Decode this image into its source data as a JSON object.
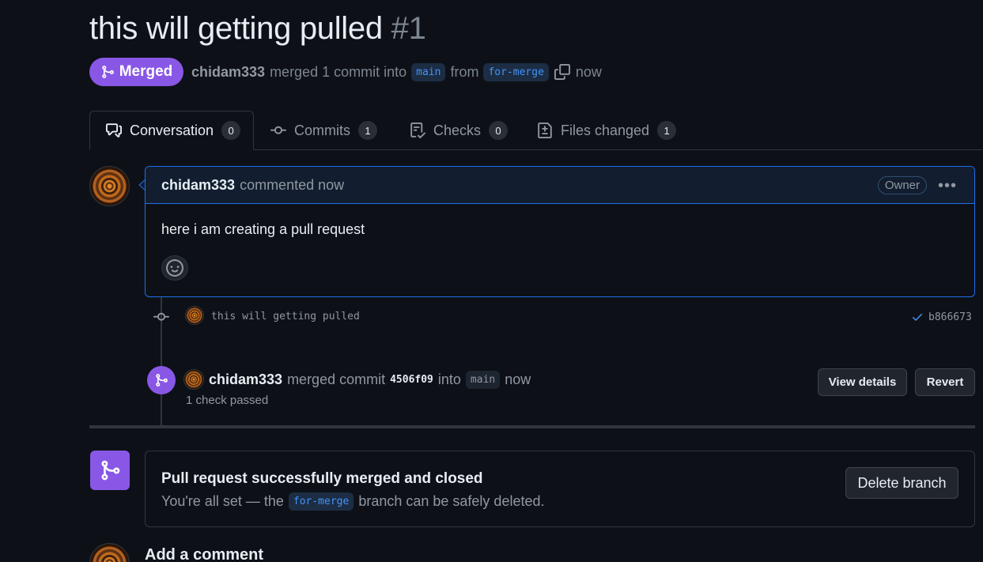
{
  "pr": {
    "title": "this will getting pulled",
    "number": "#1",
    "state": "Merged",
    "author": "chidam333",
    "merged_text": "merged 1 commit into",
    "base_branch": "main",
    "from_text": "from",
    "head_branch": "for-merge",
    "time": "now"
  },
  "tabs": [
    {
      "label": "Conversation",
      "count": "0",
      "icon": "comment-discussion-icon"
    },
    {
      "label": "Commits",
      "count": "1",
      "icon": "git-commit-icon"
    },
    {
      "label": "Checks",
      "count": "0",
      "icon": "checklist-icon"
    },
    {
      "label": "Files changed",
      "count": "1",
      "icon": "file-diff-icon"
    }
  ],
  "comment": {
    "author": "chidam333",
    "action": "commented now",
    "role": "Owner",
    "body": "here i am creating a pull request"
  },
  "commit": {
    "message": "this will getting pulled",
    "sha": "b866673"
  },
  "merge_event": {
    "author": "chidam333",
    "text": "merged commit",
    "sha": "4506f09",
    "into": "into",
    "branch": "main",
    "time": "now",
    "checks": "1 check passed",
    "view_details": "View details",
    "revert": "Revert"
  },
  "merge_box": {
    "title": "Pull request successfully merged and closed",
    "sub_before": "You're all set — the",
    "branch": "for-merge",
    "sub_after": "branch can be safely deleted.",
    "delete_button": "Delete branch"
  },
  "add_comment": {
    "heading": "Add a comment"
  },
  "colors": {
    "background": "#0d1117",
    "merged_purple": "#8957e5",
    "accent_blue": "#1f6feb"
  }
}
